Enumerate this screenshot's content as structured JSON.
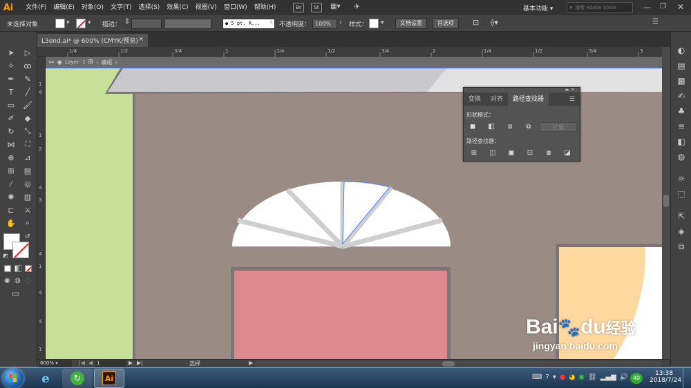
{
  "app": {
    "logo": "Ai",
    "accent": "#ff9a00"
  },
  "menu": [
    "文件(F)",
    "编辑(E)",
    "对象(O)",
    "文字(T)",
    "选择(S)",
    "效果(C)",
    "视图(V)",
    "窗口(W)",
    "帮助(H)"
  ],
  "menubar_icons": {
    "br": "Br",
    "st": "St"
  },
  "workspace": "基本功能",
  "search_placeholder": "搜索 Adobe Stock",
  "control": {
    "no_selection": "未选择对象",
    "stroke_label": "描边：",
    "brush": "● 5 pt. R...",
    "opacity_label": "不透明度：",
    "opacity": "100%",
    "style_label": "样式：",
    "doc_setup": "文档设置",
    "prefs": "首选项"
  },
  "doc_tab": {
    "title": "L3end.ai* @ 600% (CMYK/预览)",
    "close": "×"
  },
  "ruler_top_labels": [
    "1/4",
    "1/2",
    "3/4",
    "1",
    "1/4",
    "1/2",
    "3/4",
    "2",
    "1/4",
    "1/2",
    "3/4",
    "3"
  ],
  "ruler_left_labels": [
    "1",
    "4",
    "1",
    "2",
    "4",
    "3",
    "4",
    "1",
    "4",
    "4",
    "1"
  ],
  "isolation": {
    "layer": "Layer 1",
    "group": "编组"
  },
  "pathfinder": {
    "tabs": [
      "变换",
      "对齐",
      "路径查找器"
    ],
    "shape_modes": "形状模式：",
    "expand": "扩展",
    "pathfinders": "路径查找器："
  },
  "status": {
    "zoom": "600%",
    "page": "1",
    "tool": "选择"
  },
  "clock": {
    "time": "13:38",
    "date": "2018/7/24"
  },
  "tray_badge": "40",
  "watermark": {
    "brand": "Bai",
    "paw": "du",
    "cn": "经验",
    "url": "jingyan.baidu.com"
  }
}
